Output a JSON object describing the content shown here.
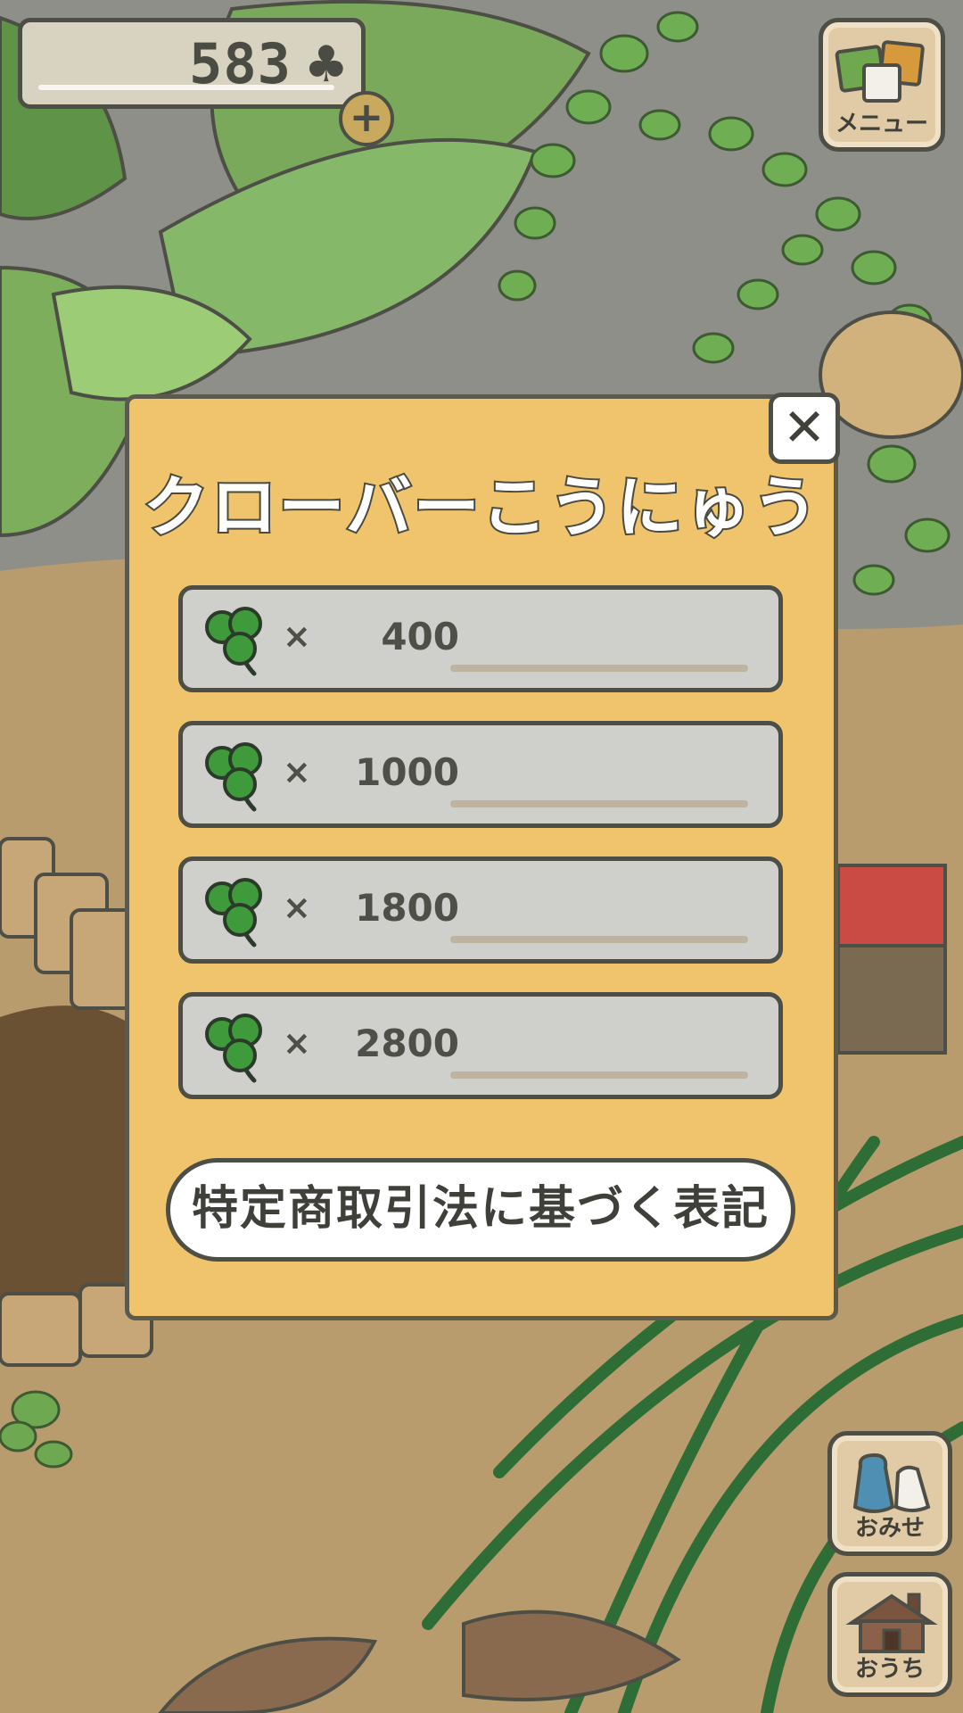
{
  "currency": {
    "count": "583",
    "symbol": "♣",
    "add_label": "+"
  },
  "menu_button": {
    "label": "メニュー"
  },
  "purchase_dialog": {
    "title": "クローバーこうにゅう",
    "close_label": "✕",
    "packages": [
      {
        "times": "×",
        "quantity": "400"
      },
      {
        "times": "×",
        "quantity": "1000"
      },
      {
        "times": "×",
        "quantity": "1800"
      },
      {
        "times": "×",
        "quantity": "2800"
      }
    ],
    "legal_notice_label": "特定商取引法に基づく表記"
  },
  "nav": {
    "shop_label": "おみせ",
    "home_label": "おうち"
  },
  "icons": {
    "currency": "club-icon",
    "package": "clover-icon",
    "menu": "cards-icon",
    "shop": "bags-icon",
    "home": "house-icon"
  },
  "colors": {
    "dialog_bg": "#efc46d",
    "package_bg": "#cfcfcc",
    "outline": "#4d4e45",
    "clover_green": "#3f9a3c"
  }
}
